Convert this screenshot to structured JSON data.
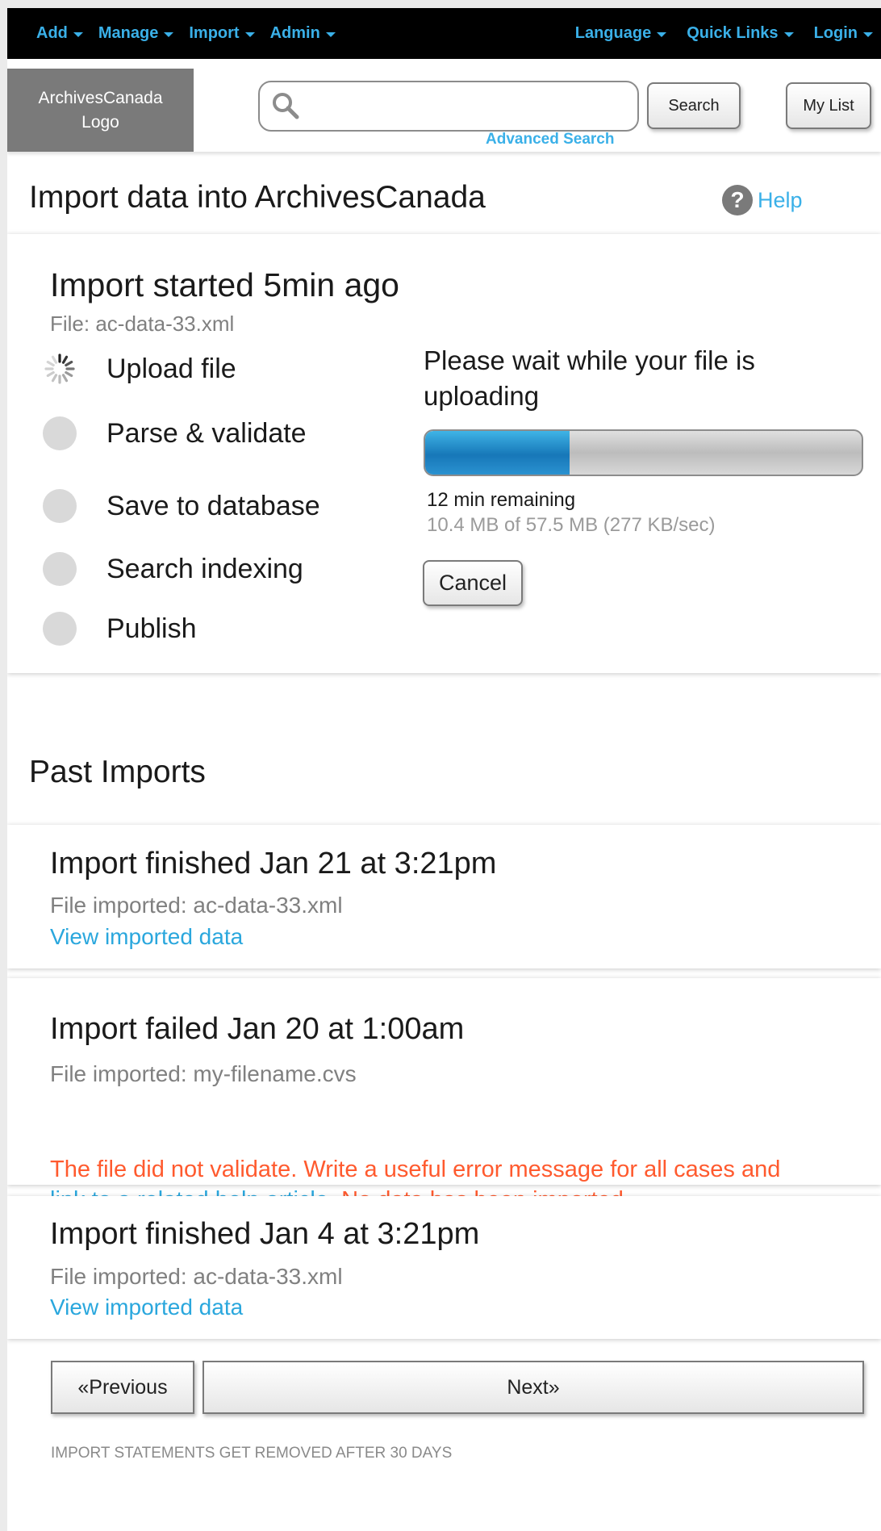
{
  "nav": {
    "left": [
      "Add",
      "Manage",
      "Import",
      "Admin"
    ],
    "right": [
      "Language",
      "Quick Links",
      "Login"
    ]
  },
  "header": {
    "logo_line1": "ArchivesCanada",
    "logo_line2": "Logo",
    "search_placeholder": "",
    "search_button": "Search",
    "advanced_search": "Advanced Search",
    "my_list": "My List"
  },
  "page": {
    "title": "Import data into ArchivesCanada",
    "help": "Help",
    "help_icon": "?"
  },
  "current_import": {
    "title": "Import started 5min ago",
    "file": "File: ac-data-33.xml",
    "steps": [
      {
        "label": "Upload file",
        "state": "in-progress"
      },
      {
        "label": "Parse & validate",
        "state": "pending"
      },
      {
        "label": "Save to database",
        "state": "pending"
      },
      {
        "label": "Search indexing",
        "state": "pending"
      },
      {
        "label": "Publish",
        "state": "pending"
      }
    ],
    "wait_message": "Please wait while your file is uploading",
    "progress_fraction": 0.33,
    "remaining": "12 min remaining",
    "transfer": "10.4 MB of 57.5 MB (277 KB/sec)",
    "cancel": "Cancel"
  },
  "past_imports": {
    "title": "Past Imports",
    "items": [
      {
        "title": "Import finished Jan 21 at 3:21pm",
        "file": "File imported: ac-data-33.xml",
        "link": "View imported data"
      },
      {
        "title": "Import failed Jan 20 at 1:00am",
        "file": "File imported: my-filename.cvs",
        "error_part1": "The file did not validate. Write a useful error message for all cases and",
        "error_link": "link to a related help article",
        "error_part2": ". No data has been imported."
      },
      {
        "title": "Import finished Jan 4 at 3:21pm",
        "file": "File imported: ac-data-33.xml",
        "link": "View imported data"
      }
    ]
  },
  "pager": {
    "previous": "«Previous",
    "next": "Next»"
  },
  "footnote": "IMPORT STATEMENTS GET REMOVED AFTER 30 DAYS",
  "colors": {
    "accent": "#3ab0e8",
    "error": "#ff5a2e",
    "nav_bg": "#000000",
    "progress": "#1e88c8"
  }
}
